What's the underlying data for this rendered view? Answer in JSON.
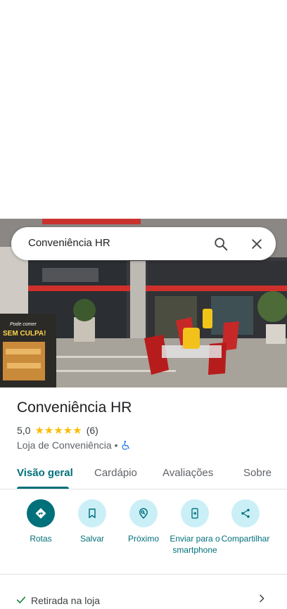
{
  "search": {
    "query": "Conveniência HR",
    "icon_search": "search-icon",
    "icon_close": "close-icon"
  },
  "photo": {
    "sign_line1": "Pode comer",
    "sign_line2": "SEM CULPA!"
  },
  "place": {
    "name": "Conveniência HR",
    "rating": "5,0",
    "stars": "★★★★★",
    "review_count": "(6)",
    "category": "Loja de Conveniência",
    "separator": "•",
    "accessibility_icon": "wheelchair-icon"
  },
  "tabs": [
    {
      "label": "Visão geral",
      "active": true
    },
    {
      "label": "Cardápio"
    },
    {
      "label": "Avaliações"
    },
    {
      "label": "Sobre"
    }
  ],
  "actions": [
    {
      "label": "Rotas",
      "icon": "directions-icon"
    },
    {
      "label": "Salvar",
      "icon": "bookmark-icon"
    },
    {
      "label": "Próximo",
      "icon": "nearby-icon"
    },
    {
      "label": "Enviar para o smartphone",
      "icon": "send-to-phone-icon"
    },
    {
      "label": "Compartilhar",
      "icon": "share-icon"
    }
  ],
  "amenity": {
    "label": "Retirada na loja",
    "icon": "check-icon"
  },
  "colors": {
    "accent": "#00707a",
    "action_bg": "#cbeff7",
    "star": "#fbbc04"
  }
}
